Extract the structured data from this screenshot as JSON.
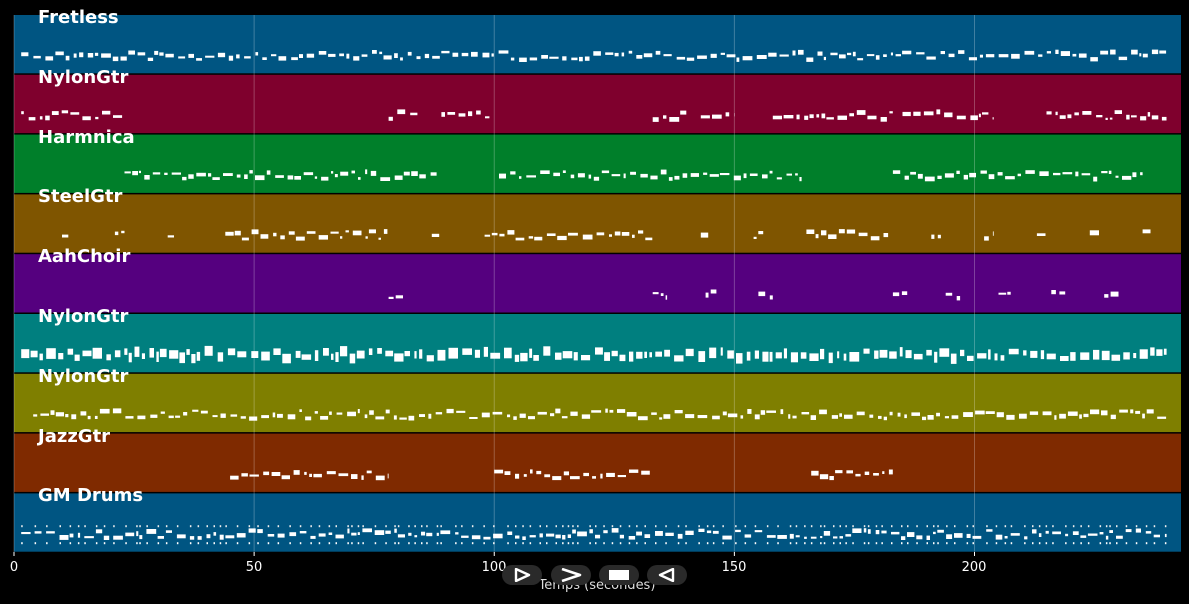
{
  "chart_data": {
    "type": "piano-roll",
    "xlabel": "Temps (secondes)",
    "xlim": [
      0,
      243
    ],
    "x_ticks": [
      "0",
      "50",
      "100",
      "150",
      "200"
    ],
    "x_tick_values": [
      0,
      50,
      100,
      150,
      200
    ],
    "grid": true,
    "tracks": [
      {
        "name": "Fretless",
        "color": "#005582",
        "active": [
          [
            1.5,
            240
          ]
        ]
      },
      {
        "name": "NylonGtr",
        "color": "#7f002d",
        "active": [
          [
            1.5,
            23
          ],
          [
            78,
            84
          ],
          [
            89,
            99
          ],
          [
            133,
            140
          ],
          [
            143,
            150
          ],
          [
            158,
            183
          ],
          [
            185,
            204
          ],
          [
            215,
            240
          ]
        ]
      },
      {
        "name": "Harmnica",
        "color": "#007f2a",
        "active": [
          [
            23,
            88
          ],
          [
            101,
            164
          ],
          [
            183,
            235
          ]
        ]
      },
      {
        "name": "SteelGtr",
        "color": "#7f5500",
        "active": [
          [
            10,
            12
          ],
          [
            21,
            23
          ],
          [
            32,
            34
          ],
          [
            44,
            78
          ],
          [
            87,
            89
          ],
          [
            98,
            133
          ],
          [
            143,
            145
          ],
          [
            154,
            156
          ],
          [
            165,
            182
          ],
          [
            191,
            193
          ],
          [
            202,
            204
          ],
          [
            213,
            215
          ],
          [
            224,
            226
          ],
          [
            235,
            237
          ]
        ]
      },
      {
        "name": "AahChoir",
        "color": "#55007f",
        "active": [
          [
            78,
            81
          ],
          [
            133,
            136
          ],
          [
            144,
            147
          ],
          [
            155,
            158
          ],
          [
            183,
            186
          ],
          [
            194,
            197
          ],
          [
            205,
            208
          ],
          [
            216,
            219
          ],
          [
            227,
            230
          ]
        ]
      },
      {
        "name": "NylonGtr",
        "color": "#007f7f",
        "active": [
          [
            1.5,
            240
          ]
        ]
      },
      {
        "name": "NylonGtr",
        "color": "#7f7f00",
        "active": [
          [
            4,
            240
          ]
        ]
      },
      {
        "name": "JazzGtr",
        "color": "#7f2a00",
        "active": [
          [
            45,
            78
          ],
          [
            100,
            133
          ],
          [
            166,
            183
          ]
        ]
      },
      {
        "name": "GM Drums",
        "color": "#005582",
        "active": [
          [
            1.5,
            240
          ]
        ]
      }
    ]
  },
  "transport": {
    "play_icon": "play-icon",
    "forward_icon": "fast-forward-icon",
    "stop_icon": "stop-icon",
    "rewind_icon": "rewind-icon"
  }
}
